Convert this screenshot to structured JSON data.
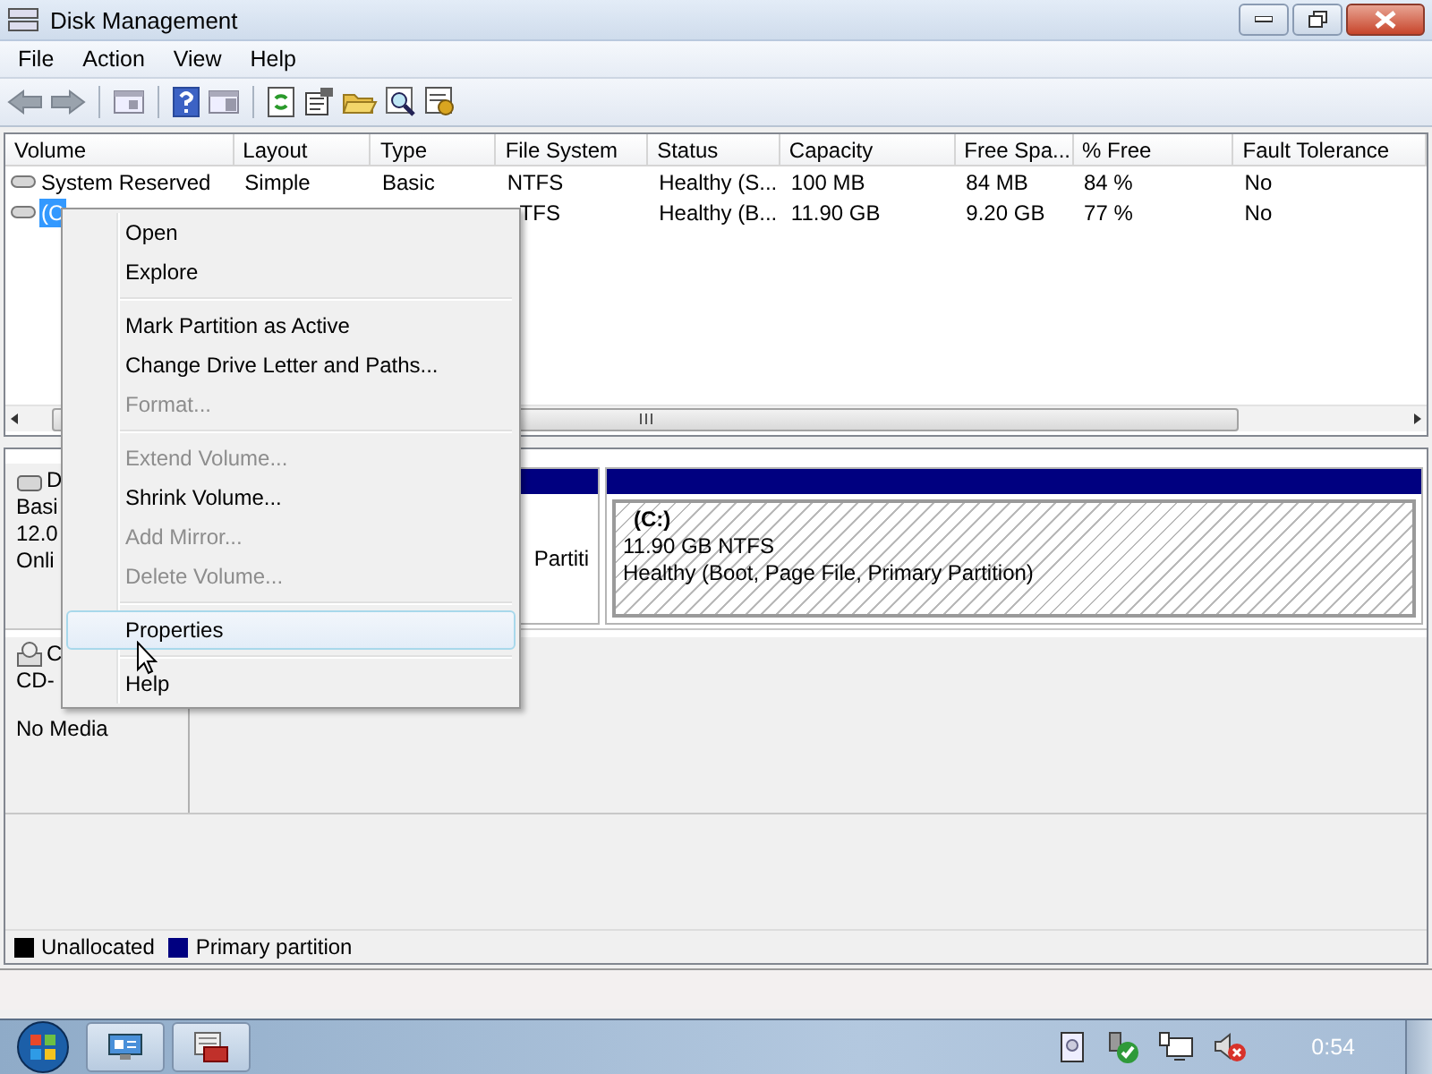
{
  "window": {
    "title": "Disk Management"
  },
  "menu_bar": [
    "File",
    "Action",
    "View",
    "Help"
  ],
  "table": {
    "columns": [
      "Volume",
      "Layout",
      "Type",
      "File System",
      "Status",
      "Capacity",
      "Free Spa...",
      "% Free",
      "Fault Tolerance"
    ],
    "rows": [
      {
        "selected": false,
        "volume": "System Reserved",
        "layout": "Simple",
        "type": "Basic",
        "file_system": "NTFS",
        "status": "Healthy (S...",
        "capacity": "100 MB",
        "free_space": "84 MB",
        "percent_free": "84 %",
        "fault_tolerance": "No"
      },
      {
        "selected": true,
        "volume": "(C",
        "file_system": "TFS",
        "status": "Healthy (B...",
        "capacity": "11.90 GB",
        "free_space": "9.20 GB",
        "percent_free": "77 %",
        "fault_tolerance": "No"
      }
    ]
  },
  "disks": [
    {
      "kind": "disk",
      "name": "D",
      "lines": [
        "Basi",
        "12.0",
        "Onli"
      ],
      "partitions": [
        {
          "selected": false,
          "lines": [
            "Partiti"
          ]
        },
        {
          "selected": true,
          "name": "(C:)",
          "lines": [
            "11.90 GB NTFS",
            "Healthy (Boot, Page File, Primary Partition)"
          ]
        }
      ]
    },
    {
      "kind": "cdrom",
      "name": "C",
      "lines": [
        "CD-"
      ],
      "media": "No Media"
    }
  ],
  "legend": [
    {
      "label": "Unallocated",
      "color": "#000000"
    },
    {
      "label": "Primary partition",
      "color": "#000080"
    }
  ],
  "context_menu": [
    {
      "kind": "item",
      "label": "Open",
      "disabled": false,
      "selected": false
    },
    {
      "kind": "item",
      "label": "Explore",
      "disabled": false,
      "selected": false
    },
    {
      "kind": "separator"
    },
    {
      "kind": "item",
      "label": "Mark Partition as Active",
      "disabled": false,
      "selected": false
    },
    {
      "kind": "item",
      "label": "Change Drive Letter and Paths...",
      "disabled": false,
      "selected": false
    },
    {
      "kind": "item",
      "label": "Format...",
      "disabled": true,
      "selected": false
    },
    {
      "kind": "separator"
    },
    {
      "kind": "item",
      "label": "Extend Volume...",
      "disabled": true,
      "selected": false
    },
    {
      "kind": "item",
      "label": "Shrink Volume...",
      "disabled": false,
      "selected": false
    },
    {
      "kind": "item",
      "label": "Add Mirror...",
      "disabled": true,
      "selected": false
    },
    {
      "kind": "item",
      "label": "Delete Volume...",
      "disabled": true,
      "selected": false
    },
    {
      "kind": "separator"
    },
    {
      "kind": "item",
      "label": "Properties",
      "disabled": false,
      "selected": true
    },
    {
      "kind": "separator"
    },
    {
      "kind": "item",
      "label": "Help",
      "disabled": false,
      "selected": false
    }
  ],
  "taskbar": {
    "clock": "0:54"
  }
}
